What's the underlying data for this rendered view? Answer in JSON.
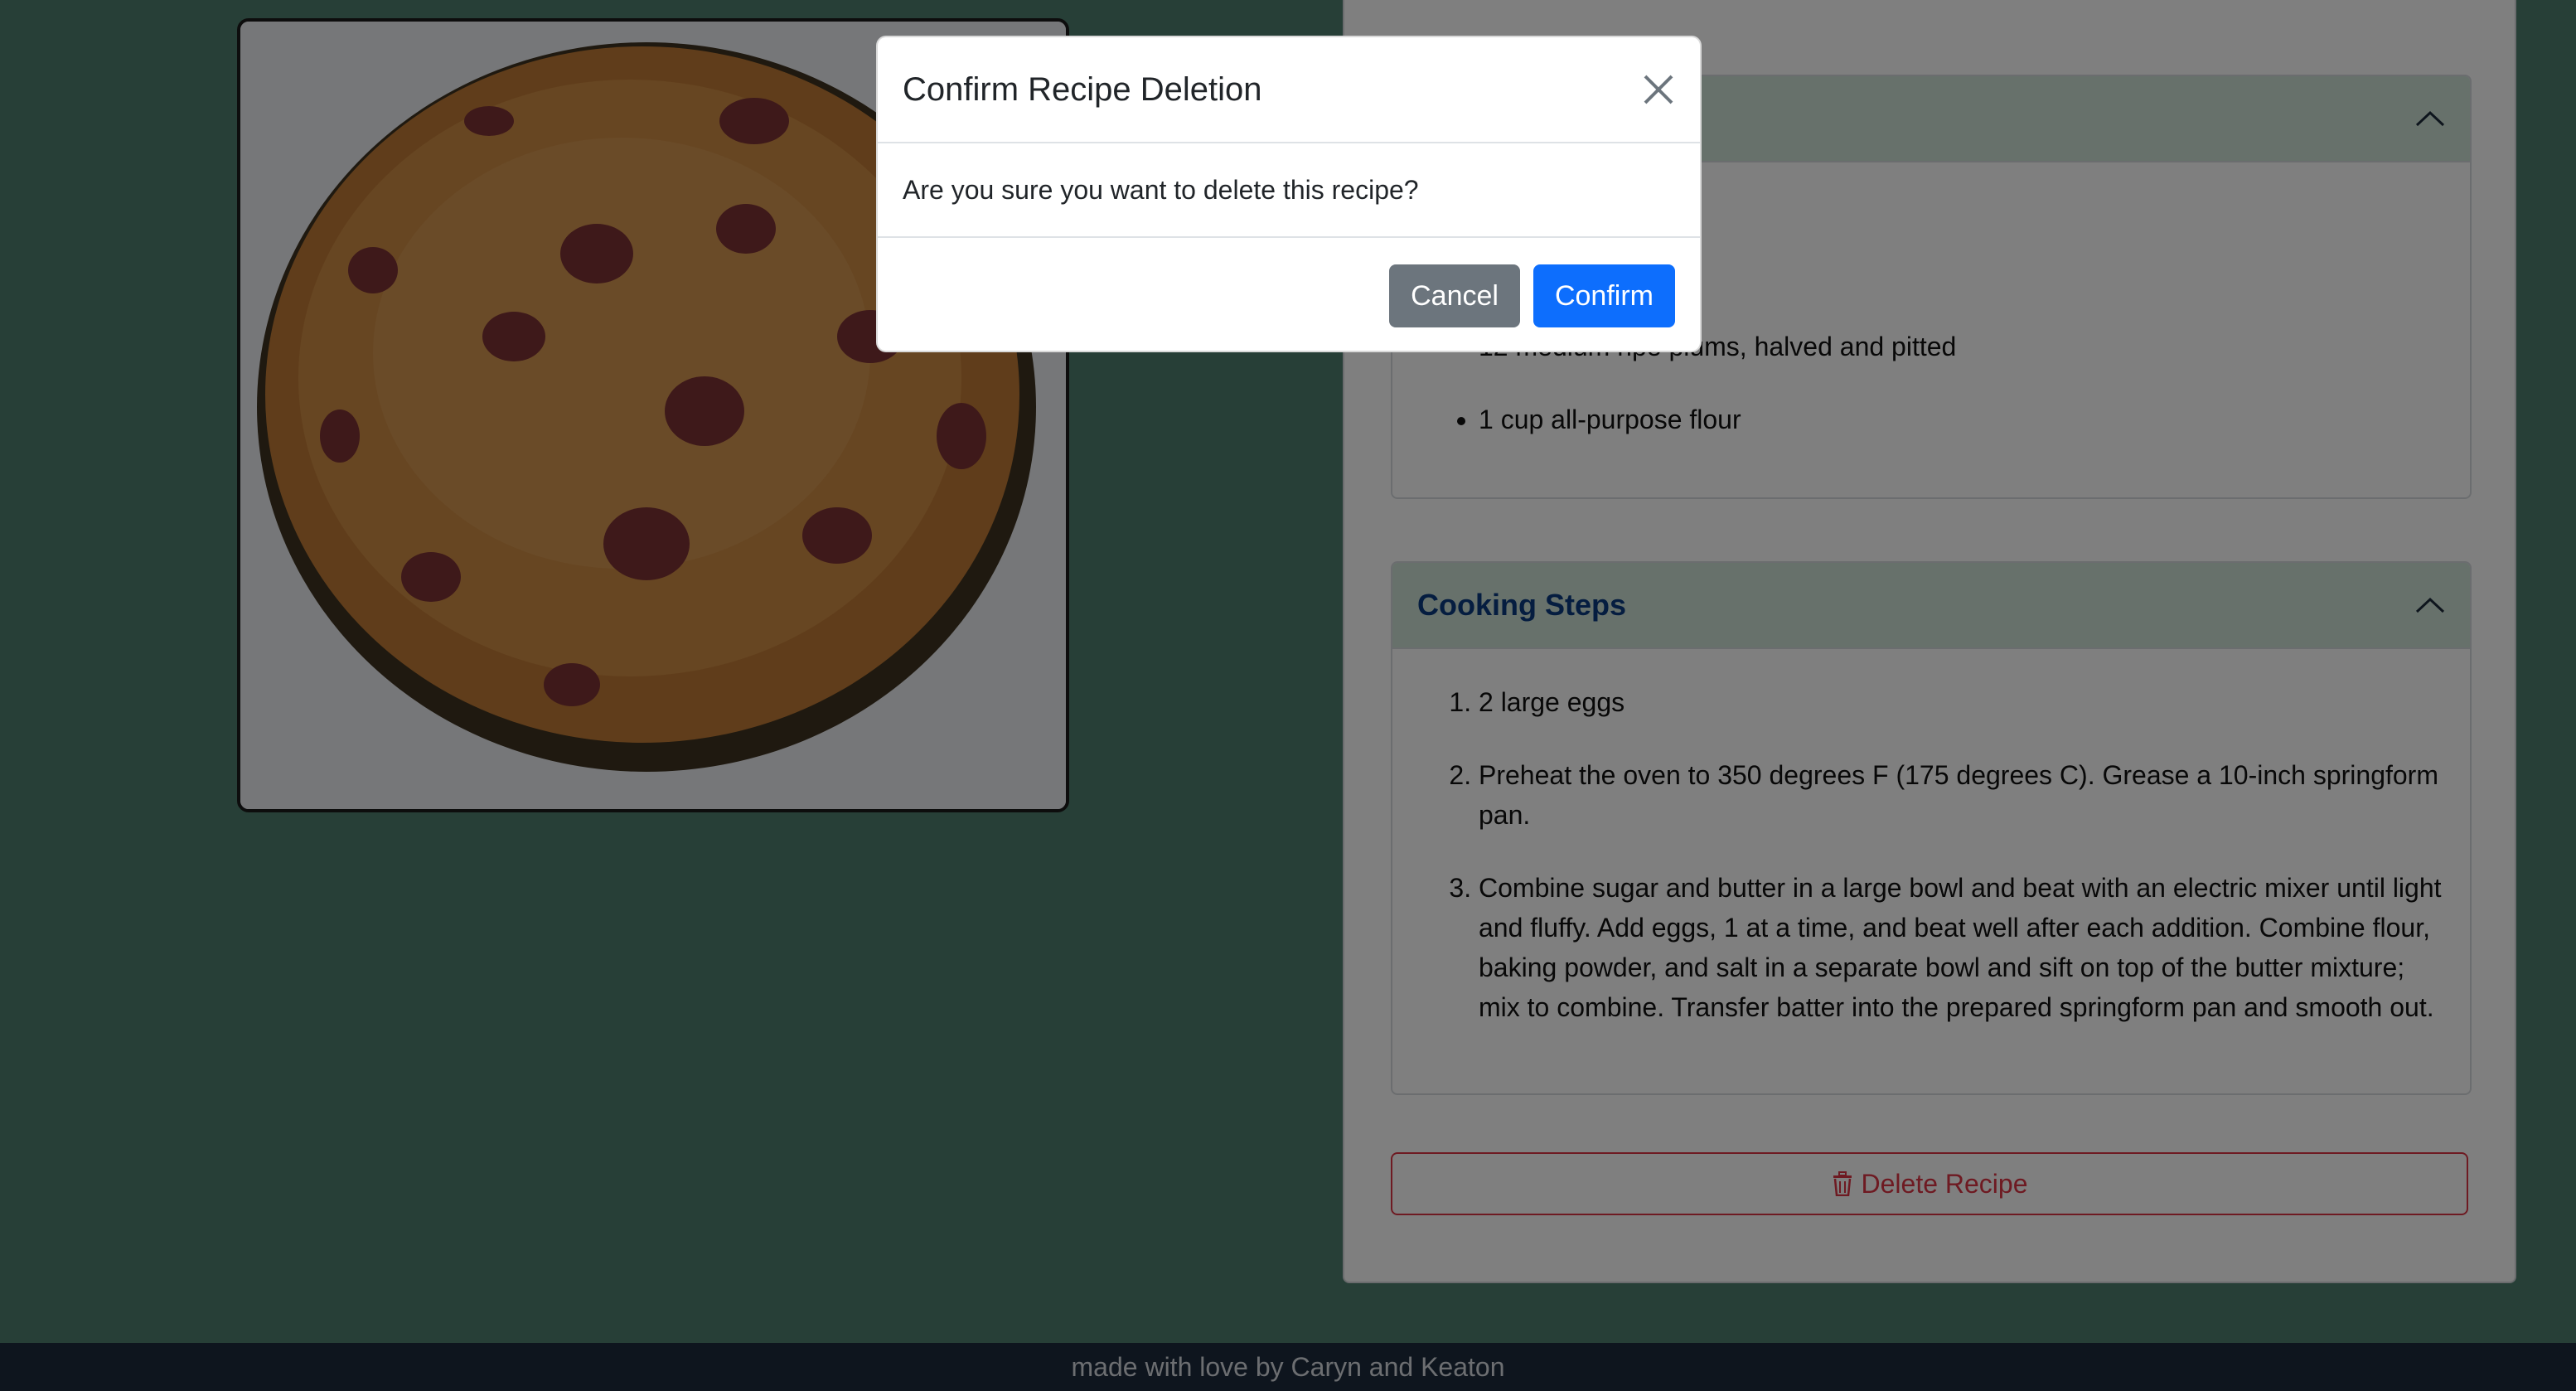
{
  "photo": {
    "alt_icon": "plum-cake-photo"
  },
  "ingredients": {
    "items": [
      "12 medium ripe plums, halved and pitted",
      "1 cup all-purpose flour"
    ]
  },
  "steps": {
    "title": "Cooking Steps",
    "items": [
      "2 large eggs",
      "Preheat the oven to 350 degrees F (175 degrees C). Grease a 10-inch springform pan.",
      "Combine sugar and butter in a large bowl and beat with an electric mixer until light and fluffy. Add eggs, 1 at a time, and beat well after each addition. Combine flour, baking powder, and salt in a separate bowl and sift on top of the butter mixture; mix to combine. Transfer batter into the prepared springform pan and smooth out."
    ]
  },
  "delete_button": {
    "label": "Delete Recipe",
    "icon": "trash-icon"
  },
  "footer": {
    "text": "made with love by Caryn and Keaton"
  },
  "modal": {
    "title": "Confirm Recipe Deletion",
    "message": "Are you sure you want to delete this recipe?",
    "cancel_label": "Cancel",
    "confirm_label": "Confirm"
  },
  "colors": {
    "background": "#4f7f6e",
    "accordion_header": "#cfe2d7",
    "accent": "#0d6efd",
    "danger": "#dc3545",
    "footer": "#1d2a3c"
  }
}
